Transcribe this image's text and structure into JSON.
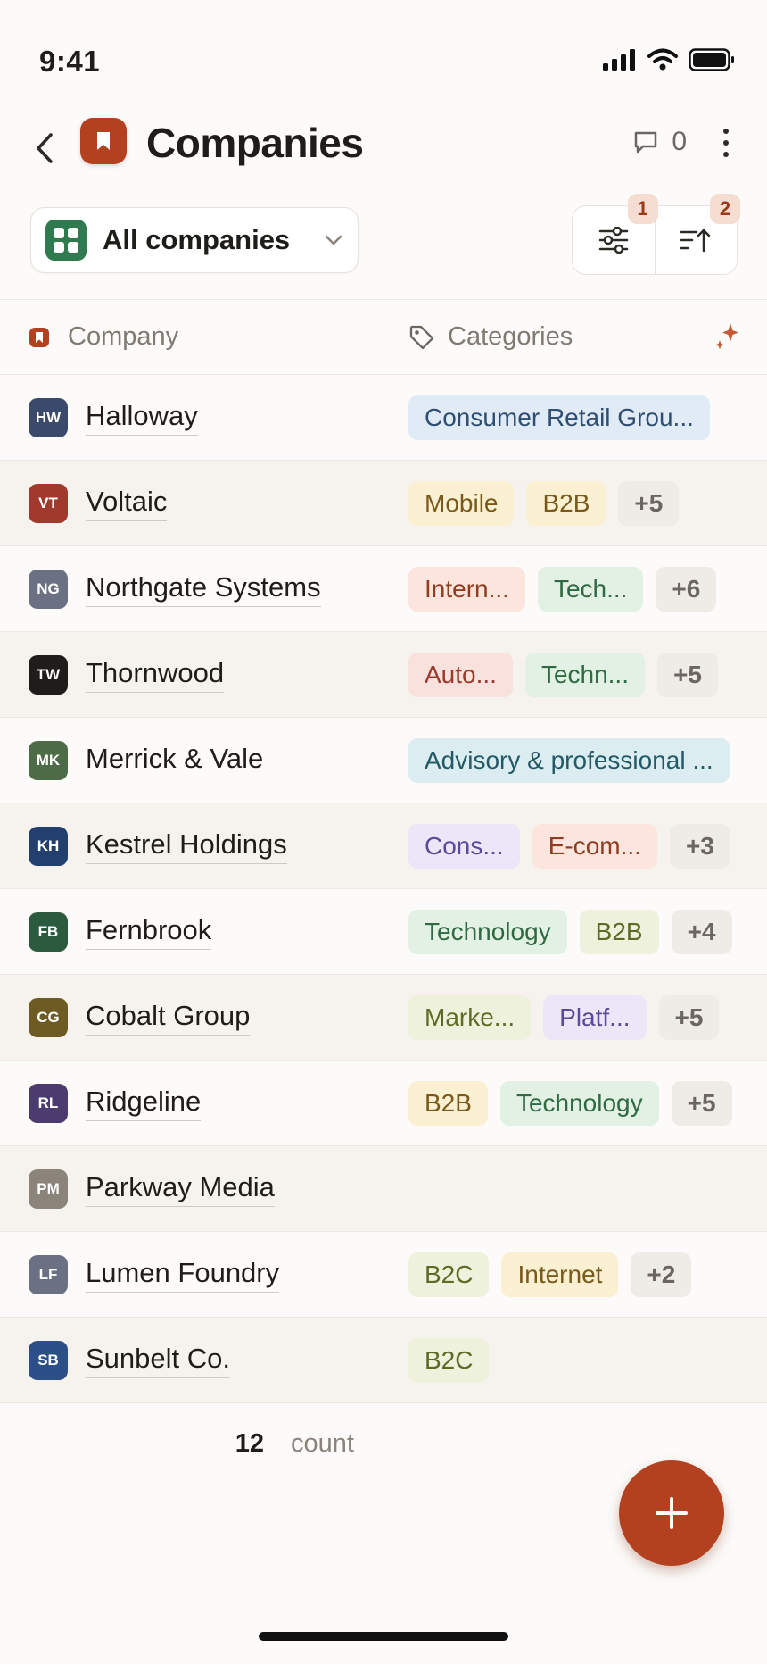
{
  "status_bar": {
    "time": "9:41"
  },
  "header": {
    "title": "Companies",
    "comment_count": "0"
  },
  "view": {
    "label": "All companies"
  },
  "toolbar": {
    "filter_badge": "1",
    "sort_badge": "2"
  },
  "table": {
    "columns": [
      "Company",
      "Categories"
    ],
    "rows": [
      {
        "initials": "HW",
        "avatar_color": "#3b4a6b",
        "name": "Halloway",
        "tags": [
          {
            "label": "Consumer Retail Grou...",
            "color": "blue"
          }
        ]
      },
      {
        "initials": "VT",
        "avatar_color": "#a03a2c",
        "name": "Voltaic",
        "tags": [
          {
            "label": "Mobile",
            "color": "yellow"
          },
          {
            "label": "B2B",
            "color": "yellow"
          },
          {
            "label": "+5",
            "color": "gray"
          }
        ]
      },
      {
        "initials": "NG",
        "avatar_color": "#6b7183",
        "name": "Northgate Systems",
        "tags": [
          {
            "label": "Intern...",
            "color": "orange"
          },
          {
            "label": "Tech...",
            "color": "green"
          },
          {
            "label": "+6",
            "color": "gray"
          }
        ]
      },
      {
        "initials": "TW",
        "avatar_color": "#1f1c1a",
        "name": "Thornwood",
        "tags": [
          {
            "label": "Auto...",
            "color": "red"
          },
          {
            "label": "Techn...",
            "color": "green"
          },
          {
            "label": "+5",
            "color": "gray"
          }
        ]
      },
      {
        "initials": "MK",
        "avatar_color": "#4d6b47",
        "name": "Merrick & Vale",
        "tags": [
          {
            "label": "Advisory & professional ...",
            "color": "teal"
          }
        ]
      },
      {
        "initials": "KH",
        "avatar_color": "#233f6e",
        "name": "Kestrel Holdings",
        "tags": [
          {
            "label": "Cons...",
            "color": "purple"
          },
          {
            "label": "E-com...",
            "color": "orange"
          },
          {
            "label": "+3",
            "color": "gray"
          }
        ]
      },
      {
        "initials": "FB",
        "avatar_color": "#2c5a3f",
        "name": "Fernbrook",
        "tags": [
          {
            "label": "Technology",
            "color": "green"
          },
          {
            "label": "B2B",
            "color": "olive"
          },
          {
            "label": "+4",
            "color": "gray"
          }
        ]
      },
      {
        "initials": "CG",
        "avatar_color": "#6e5a23",
        "name": "Cobalt Group",
        "tags": [
          {
            "label": "Marke...",
            "color": "olive"
          },
          {
            "label": "Platf...",
            "color": "purple"
          },
          {
            "label": "+5",
            "color": "gray"
          }
        ]
      },
      {
        "initials": "RL",
        "avatar_color": "#4b3b6e",
        "name": "Ridgeline",
        "tags": [
          {
            "label": "B2B",
            "color": "yellow"
          },
          {
            "label": "Technology",
            "color": "green"
          },
          {
            "label": "+5",
            "color": "gray"
          }
        ]
      },
      {
        "initials": "PM",
        "avatar_color": "#8a847b",
        "name": "Parkway Media",
        "tags": []
      },
      {
        "initials": "LF",
        "avatar_color": "#6b7183",
        "name": "Lumen Foundry",
        "tags": [
          {
            "label": "B2C",
            "color": "olive"
          },
          {
            "label": "Internet",
            "color": "yellow"
          },
          {
            "label": "+2",
            "color": "gray"
          }
        ]
      },
      {
        "initials": "SB",
        "avatar_color": "#2b4f86",
        "name": "Sunbelt Co.",
        "tags": [
          {
            "label": "B2C",
            "color": "olive"
          }
        ]
      }
    ]
  },
  "footer": {
    "count": "12",
    "count_label": "count"
  },
  "colors": {
    "accent": "#b3401f",
    "view_icon": "#2f7a4f"
  }
}
